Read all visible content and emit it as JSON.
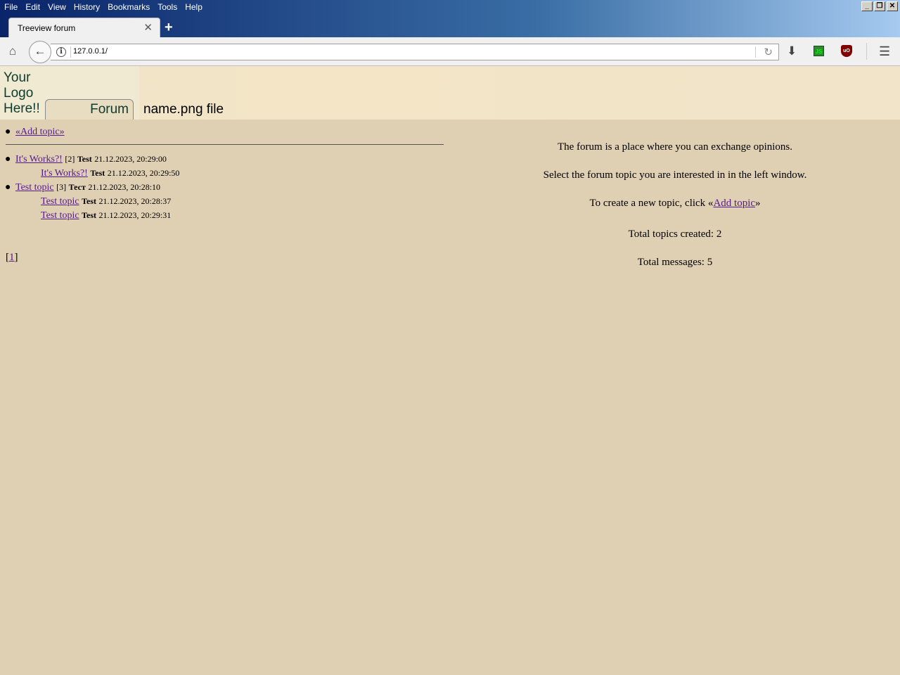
{
  "browser": {
    "menus": [
      "File",
      "Edit",
      "View",
      "History",
      "Bookmarks",
      "Tools",
      "Help"
    ],
    "tab_title": "Treeview forum",
    "url": "127.0.0.1/",
    "extensions": {
      "js": "JS",
      "ublock": "uO"
    }
  },
  "header": {
    "logo_text": "Your Logo Here!!",
    "forum_tab": "Forum",
    "heading": "name.png file"
  },
  "left": {
    "add_topic": "«Add topic»",
    "topics": [
      {
        "title": "It's Works?!",
        "count": "[2]",
        "author": "Test",
        "date": "21.12.2023, 20:29:00",
        "replies": [
          {
            "title": "It's Works?!",
            "author": "Test",
            "date": "21.12.2023, 20:29:50"
          }
        ]
      },
      {
        "title": "Test topic",
        "count": "[3]",
        "author": "Тест",
        "date": "21.12.2023, 20:28:10",
        "replies": [
          {
            "title": "Test topic",
            "author": "Test",
            "date": "21.12.2023, 20:28:37"
          },
          {
            "title": "Test topic",
            "author": "Test",
            "date": "21.12.2023, 20:29:31"
          }
        ]
      }
    ],
    "pager": {
      "open": "[",
      "page": "1",
      "close": "]"
    }
  },
  "right": {
    "line1": "The forum is a place where you can exchange opinions.",
    "line2": "Select the forum topic you are interested in in the left window.",
    "line3_prefix": "To create a new topic, click «",
    "line3_link": "Add topic",
    "line3_suffix": "»",
    "line4": "Total topics created: 2",
    "line5": "Total messages: 5"
  }
}
